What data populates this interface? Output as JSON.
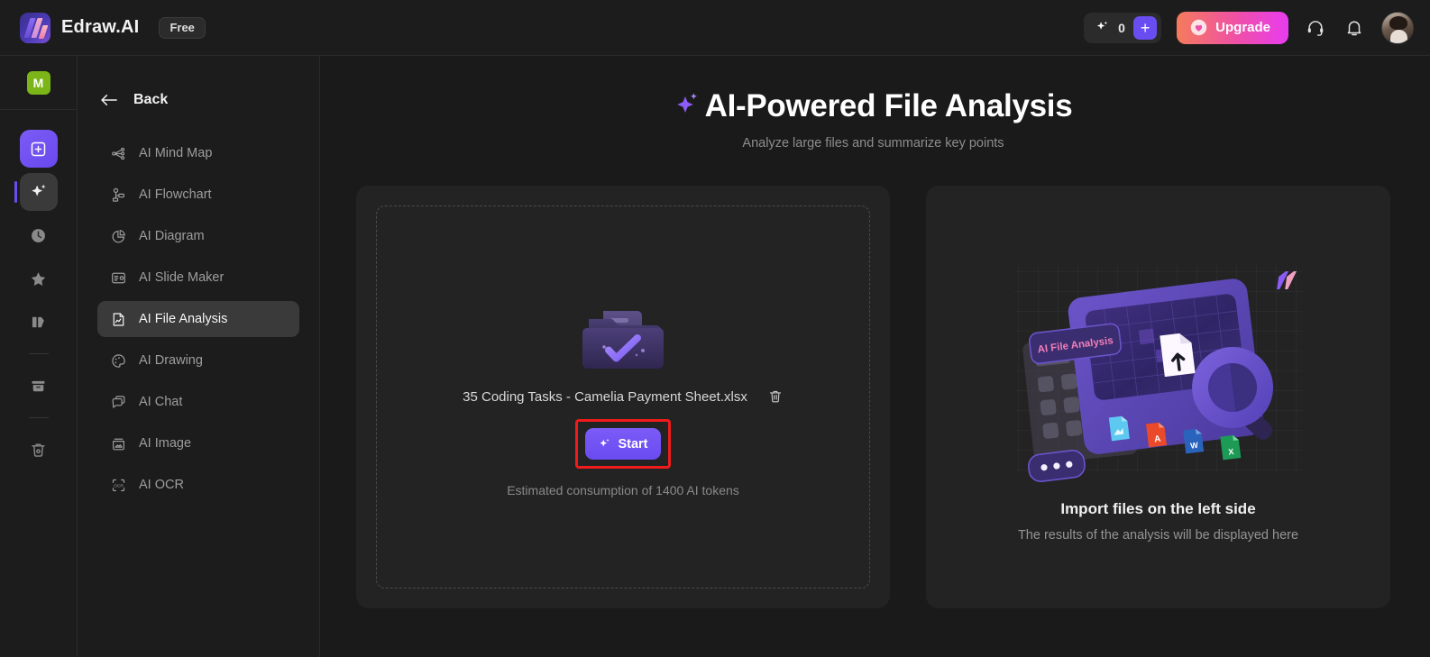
{
  "app": {
    "brand_name": "Edraw.AI",
    "plan_badge": "Free"
  },
  "topbar": {
    "token_count": "0",
    "add_tokens_label": "+",
    "upgrade_label": "Upgrade",
    "icons": {
      "sparkle": "sparkle-icon",
      "headset": "headset-icon",
      "bell": "notification-bell-icon",
      "avatar": "user-avatar"
    }
  },
  "rail": {
    "workspace_initial": "M",
    "items": [
      {
        "name": "new-file",
        "icon": "plus-square-icon"
      },
      {
        "name": "ai-tools",
        "icon": "sparkle-icon"
      },
      {
        "name": "recent",
        "icon": "clock-icon"
      },
      {
        "name": "favorites",
        "icon": "star-icon"
      },
      {
        "name": "templates",
        "icon": "gallery-icon"
      },
      {
        "name": "archive",
        "icon": "archive-box-icon"
      },
      {
        "name": "trash",
        "icon": "trash-icon"
      }
    ]
  },
  "nav": {
    "back_label": "Back",
    "items": [
      {
        "label": "AI Mind Map",
        "icon": "mind-map-icon",
        "active": false
      },
      {
        "label": "AI Flowchart",
        "icon": "flowchart-icon",
        "active": false
      },
      {
        "label": "AI Diagram",
        "icon": "pie-chart-icon",
        "active": false
      },
      {
        "label": "AI Slide Maker",
        "icon": "slide-icon",
        "active": false
      },
      {
        "label": "AI File Analysis",
        "icon": "file-analysis-icon",
        "active": true
      },
      {
        "label": "AI Drawing",
        "icon": "palette-icon",
        "active": false
      },
      {
        "label": "AI Chat",
        "icon": "chat-bubble-icon",
        "active": false
      },
      {
        "label": "AI Image",
        "icon": "image-icon",
        "active": false
      },
      {
        "label": "AI OCR",
        "icon": "ocr-icon",
        "active": false
      }
    ]
  },
  "main": {
    "title": "AI-Powered File Analysis",
    "subtitle": "Analyze large files and summarize key points",
    "upload": {
      "file_name": "35 Coding Tasks - Camelia Payment Sheet.xlsx",
      "delete_icon": "trash-icon",
      "start_label": "Start",
      "estimate_text": "Estimated consumption of 1400 AI tokens",
      "folder_icon": "folder-check-icon",
      "highlighted": true
    },
    "result": {
      "illustration_badge": "AI File Analysis",
      "title": "Import files on the left side",
      "subtitle": "The results of the analysis will be displayed here",
      "file_type_icons": [
        "image-file",
        "pdf-file",
        "word-file",
        "excel-file"
      ]
    }
  },
  "colors": {
    "accent_purple": "#6a4df0",
    "upgrade_gradient_start": "#f57b5c",
    "upgrade_gradient_end": "#e83cf0",
    "highlight_red": "#f01b1b",
    "workspace_green": "#7cb518",
    "page_background": "#1a1a1a",
    "panel_background": "#232323"
  }
}
